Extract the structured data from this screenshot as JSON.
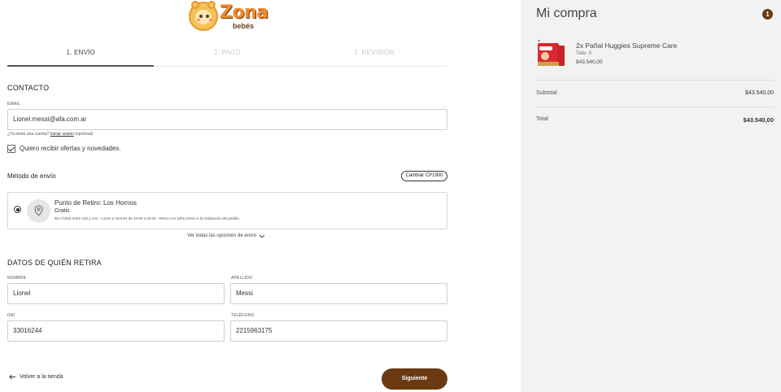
{
  "brand": {
    "logo_text": "Zona",
    "logo_subtext": "bebés"
  },
  "steps": [
    {
      "label": "1. ENVÍO",
      "active": true
    },
    {
      "label": "2. PAGO",
      "active": false
    },
    {
      "label": "3. REVISIÓN",
      "active": false
    }
  ],
  "contact": {
    "title": "CONTACTO",
    "email_label": "EMAIL",
    "email_value": "Lionel.messi@afa.com.ar",
    "hint_prefix": "¿Ya tenés una cuenta?",
    "hint_link": "Iniciar sesión",
    "hint_suffix": "(opcional)",
    "newsletter_label": "Quiero recibir ofertas y novedades.",
    "newsletter_checked": true
  },
  "shipping": {
    "title": "Método de envío",
    "change_cp_button": "Cambiar CP1900",
    "option": {
      "title": "Punto de Retiro: Los Hornos",
      "price": "Gratis",
      "description": "60 n°1934 entre 133 y 134 - Lunes a Viernes de 10:00 a 20:00 - Retiro con 24hs previo a la realización del pedido",
      "selected": true
    },
    "more_options": "Ver todas las opciones de envío"
  },
  "pickup": {
    "title": "DATOS DE QUIÉN RETIRA",
    "name_label": "NOMBRE",
    "name_value": "Lionel",
    "lastname_label": "APELLIDO",
    "lastname_value": "Messi",
    "dni_label": "DNI",
    "dni_value": "33016244",
    "phone_label": "TELÉFONO",
    "phone_value": "2215963175"
  },
  "footer": {
    "back_link": "Volver a la tienda",
    "next_button": "Siguiente"
  },
  "cart": {
    "title": "Mi compra",
    "count": "1",
    "items": [
      {
        "name": "2x Pañal Huggies Supreme Care",
        "size": "Talle: 9",
        "price": "$43.540,00"
      }
    ],
    "subtotal_label": "Subtotal",
    "subtotal_value": "$43.540,00",
    "total_label": "Total",
    "total_value": "$43.540,00"
  },
  "colors": {
    "accent": "#6b3a12",
    "logo_orange": "#f08a2a",
    "sidebar_bg": "#f2f2f2"
  }
}
